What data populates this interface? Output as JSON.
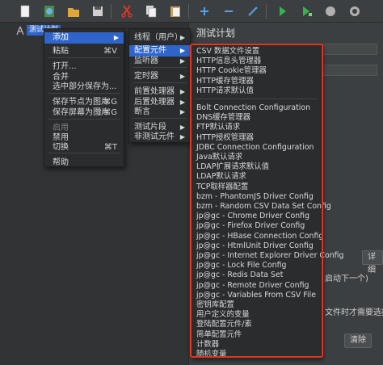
{
  "toolbar": {
    "buttons": [
      {
        "icon": "new-icon"
      },
      {
        "icon": "templates-icon"
      },
      {
        "icon": "open-icon"
      },
      {
        "icon": "save-icon"
      },
      {
        "icon": "cut-icon"
      },
      {
        "icon": "copy-icon"
      },
      {
        "icon": "paste-icon"
      },
      {
        "icon": "expand-icon"
      },
      {
        "icon": "collapse-icon"
      },
      {
        "icon": "toggle-icon"
      },
      {
        "icon": "start-icon"
      },
      {
        "icon": "start-no-pause-icon"
      },
      {
        "icon": "stop-icon"
      },
      {
        "icon": "shutdown-icon"
      }
    ],
    "colors": {
      "cut": "#e03523",
      "start": "#36b34a",
      "stop": "#b0b0b0"
    }
  },
  "tree": {
    "root_label": "测试计划"
  },
  "panel": {
    "title": "测试计划",
    "reset_label": "详细",
    "clear_label": "清除",
    "text_continue": "启动下一个)",
    "text_file": "文件时才需要选择此"
  },
  "context_menu": {
    "items": [
      {
        "label": "添加",
        "shortcut": "",
        "submenu": true,
        "active": true,
        "disabled": false
      },
      {
        "label": "粘贴",
        "shortcut": "⌘V",
        "submenu": false,
        "active": false,
        "disabled": false
      },
      {
        "label": "打开...",
        "shortcut": "",
        "submenu": false,
        "active": false,
        "disabled": false
      },
      {
        "label": "合并",
        "shortcut": "",
        "submenu": false,
        "active": false,
        "disabled": false
      },
      {
        "label": "选中部分保存为...",
        "shortcut": "",
        "submenu": false,
        "active": false,
        "disabled": false
      },
      {
        "label": "保存节点为图片",
        "shortcut": "⌘G",
        "submenu": false,
        "active": false,
        "disabled": false
      },
      {
        "label": "保存屏幕为图片",
        "shortcut": "⇧⌘G",
        "submenu": false,
        "active": false,
        "disabled": false
      },
      {
        "label": "启用",
        "shortcut": "",
        "submenu": false,
        "active": false,
        "disabled": true
      },
      {
        "label": "禁用",
        "shortcut": "",
        "submenu": false,
        "active": false,
        "disabled": false
      },
      {
        "label": "切换",
        "shortcut": "⌘T",
        "submenu": false,
        "active": false,
        "disabled": false
      },
      {
        "label": "帮助",
        "shortcut": "",
        "submenu": false,
        "active": false,
        "disabled": false
      }
    ]
  },
  "add_menu": {
    "items": [
      {
        "label": "线程（用户）",
        "active": false
      },
      {
        "label": "配置元件",
        "active": true
      },
      {
        "label": "监听器",
        "active": false
      },
      {
        "label": "定时器",
        "active": false
      },
      {
        "label": "前置处理器",
        "active": false
      },
      {
        "label": "后置处理器",
        "active": false
      },
      {
        "label": "断言",
        "active": false
      },
      {
        "label": "测试片段",
        "active": false
      },
      {
        "label": "非测试元件",
        "active": false
      }
    ]
  },
  "config_menu": {
    "items": [
      "CSV 数据文件设置",
      "HTTP信息头管理器",
      "HTTP Cookie管理器",
      "HTTP缓存管理器",
      "HTTP请求默认值",
      "Bolt Connection Configuration",
      "DNS缓存管理器",
      "FTP默认请求",
      "HTTP授权管理器",
      "JDBC Connection Configuration",
      "Java默认请求",
      "LDAP扩展请求默认值",
      "LDAP默认请求",
      "TCP取样器配置",
      "bzm - PhantomJS Driver Config",
      "bzm - Random CSV Data Set Config",
      "jp@gc - Chrome Driver Config",
      "jp@gc - Firefox Driver Config",
      "jp@gc - HBase Connection Config",
      "jp@gc - HtmlUnit Driver Config",
      "jp@gc - Internet Explorer Driver Config",
      "jp@gc - Lock File Config",
      "jp@gc - Redis Data Set",
      "jp@gc - Remote Driver Config",
      "jp@gc - Variables From CSV File",
      "密钥库配置",
      "用户定义的变量",
      "登陆配置元件/素",
      "简单配置元件",
      "计数器",
      "随机变量"
    ],
    "highlight_color": "#e03523"
  }
}
